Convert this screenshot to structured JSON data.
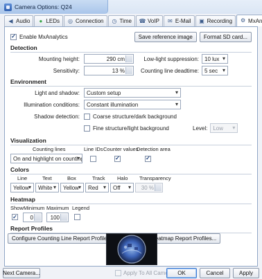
{
  "window": {
    "title": "Camera Options: Q24"
  },
  "tabs": [
    {
      "label": "Audio",
      "icon": "speaker-icon",
      "glyph": "◀"
    },
    {
      "label": "LEDs",
      "icon": "led-icon",
      "glyph": "●"
    },
    {
      "label": "Connection",
      "icon": "globe-icon",
      "glyph": "◎"
    },
    {
      "label": "Time",
      "icon": "clock-icon",
      "glyph": "◷"
    },
    {
      "label": "VoIP",
      "icon": "phone-icon",
      "glyph": "☎"
    },
    {
      "label": "E-Mail",
      "icon": "envelope-icon",
      "glyph": "✉"
    },
    {
      "label": "Recording",
      "icon": "recorder-icon",
      "glyph": "▣"
    },
    {
      "label": "MxAnalytics",
      "icon": "analytics-icon",
      "glyph": "⚙"
    }
  ],
  "active_tab": 7,
  "enable": {
    "label": "Enable MxAnalytics",
    "checked": true
  },
  "top_buttons": {
    "save_reference": "Save reference image",
    "format_sd": "Format SD card..."
  },
  "detection": {
    "header": "Detection",
    "mounting_height_label": "Mounting height:",
    "mounting_height_value": "290 cm",
    "lowlight_label": "Low-light suppression:",
    "lowlight_value": "10 lux",
    "sensitivity_label": "Sensitivity:",
    "sensitivity_value": "13 %",
    "deadtime_label": "Counting line deadtime:",
    "deadtime_value": "5 sec"
  },
  "environment": {
    "header": "Environment",
    "light_label": "Light and shadow:",
    "light_value": "Custom setup",
    "illum_label": "Illumination conditions:",
    "illum_value": "Constant illumination",
    "shadow_label": "Shadow detection:",
    "coarse_label": "Coarse structure/dark background",
    "coarse_checked": false,
    "fine_label": "Fine structure/light background",
    "fine_checked": false,
    "level_label": "Level:",
    "level_value": "Low"
  },
  "visualization": {
    "header": "Visualization",
    "col_counting_lines": "Counting lines",
    "col_line_ids": "Line IDs",
    "col_counter_values": "Counter values",
    "col_detection_area": "Detection area",
    "counting_lines_value": "On and highlight on counting",
    "line_ids_checked": false,
    "counter_values_checked": true,
    "detection_area_checked": true
  },
  "colors": {
    "header": "Colors",
    "columns": [
      "Line",
      "Text",
      "Box",
      "Track",
      "Halo",
      "Transparency"
    ],
    "values": [
      "Yellow",
      "White",
      "Yellow",
      "Red",
      "Off"
    ],
    "transparency_value": "30 %"
  },
  "heatmap": {
    "header": "Heatmap",
    "col_show": "Show",
    "col_min": "Minimum",
    "col_max": "Maximum",
    "col_legend": "Legend",
    "show_checked": true,
    "min_value": "0",
    "max_value": "100",
    "legend_checked": false
  },
  "report": {
    "header": "Report Profiles",
    "counting_button": "Configure Counting Line Report Profiles...",
    "heatmap_button": "Configure Heatmap Report Profiles..."
  },
  "footer": {
    "next_camera": "Next Camera...",
    "apply_all_label": "Apply To All Cameras",
    "apply_all_checked": false,
    "ok": "OK",
    "cancel": "Cancel",
    "apply": "Apply"
  },
  "colors_theme": {
    "accent": "#3d7bd4",
    "title_bg": "#a9c5ea",
    "led_green": "#3aa64a"
  }
}
